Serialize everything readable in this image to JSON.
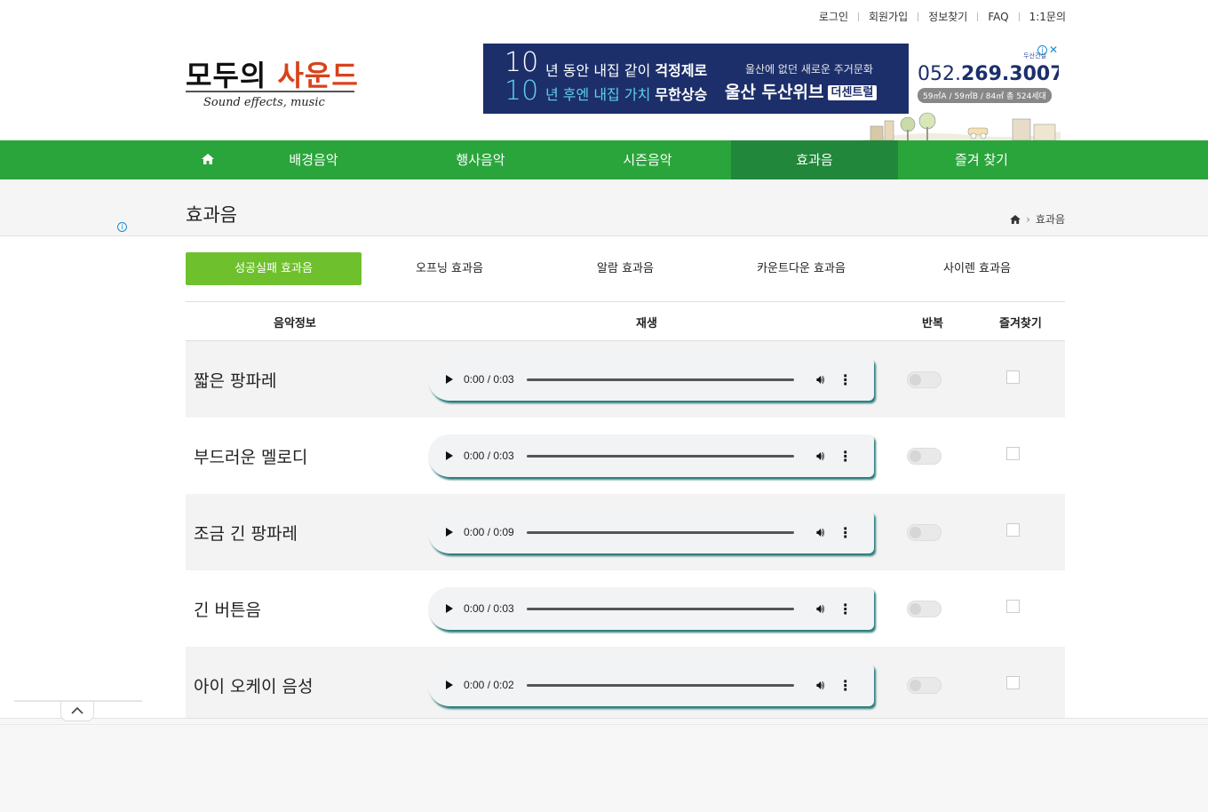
{
  "top_links": [
    "로그인",
    "회원가입",
    "정보찾기",
    "FAQ",
    "1:1문의"
  ],
  "logo": {
    "kr_main": "모두의",
    "kr_accent": "사운드",
    "en": "Sound effects, music"
  },
  "ad": {
    "digit": "10",
    "line1_a": "년 동안 내집 같이 ",
    "line1_b": "걱정제로",
    "line2_a": "년 후엔 내집 가치 ",
    "line2_b": "무한상승",
    "right_small": "울산에 없던 새로운 주거문화",
    "right_big": "울산 두산위브",
    "right_badge": "더센트럴",
    "phone_a": "052.",
    "phone_b": "269.3007",
    "sizes": "59㎡A / 59㎡B / 84㎡ 총 524세대",
    "brand": "두산건설",
    "close": "✕",
    "info": "i"
  },
  "nav": {
    "home_icon": "home-icon",
    "items": [
      {
        "label": "배경음악"
      },
      {
        "label": "행사음악"
      },
      {
        "label": "시즌음악"
      },
      {
        "label": "효과음"
      },
      {
        "label": "즐겨 찾기"
      }
    ],
    "active": "효과음",
    "active_color": "#21873a",
    "bar_color": "#2aa53b"
  },
  "page": {
    "title": "효과음",
    "breadcrumb_current": "효과음"
  },
  "subtabs": [
    {
      "label": "성공실패 효과음"
    },
    {
      "label": "오프닝 효과음"
    },
    {
      "label": "알람 효과음"
    },
    {
      "label": "카운트다운 효과음"
    },
    {
      "label": "사이렌 효과음"
    }
  ],
  "table": {
    "headers": {
      "info": "음악정보",
      "play": "재생",
      "repeat": "반복",
      "fav": "즐겨찾기"
    },
    "rows": [
      {
        "name": "짧은 팡파레",
        "time": "0:00 / 0:03"
      },
      {
        "name": "부드러운 멜로디",
        "time": "0:00 / 0:03"
      },
      {
        "name": "조금 긴 팡파레",
        "time": "0:00 / 0:09"
      },
      {
        "name": "긴 버튼음",
        "time": "0:00 / 0:03"
      },
      {
        "name": "아이 오케이 음성",
        "time": "0:00 / 0:02"
      }
    ]
  },
  "collapse_icon": "chevron-up-icon"
}
